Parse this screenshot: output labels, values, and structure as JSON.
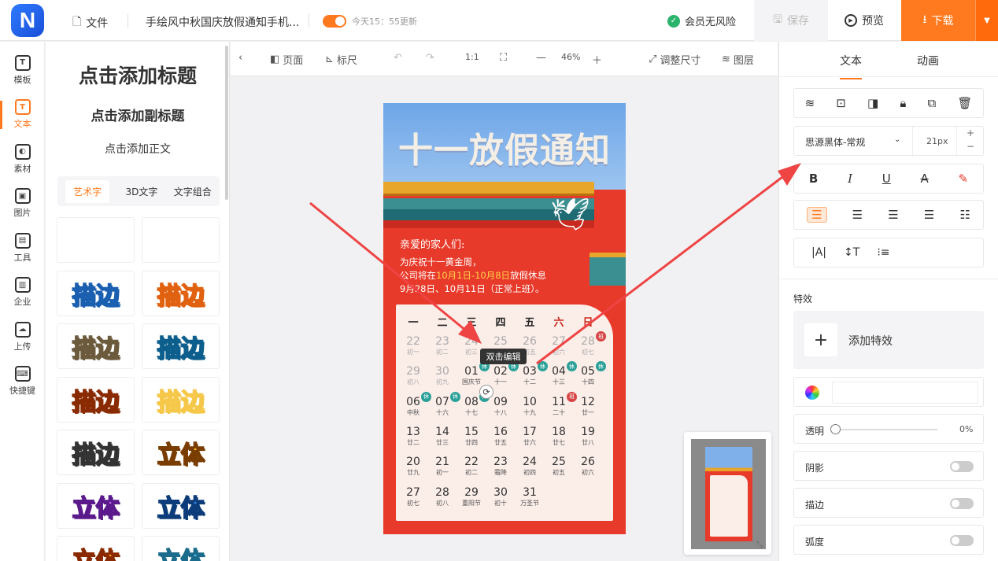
{
  "app": {
    "logo": "N"
  },
  "topbar": {
    "file_label": "文件",
    "doc_title": "手绘风中秋国庆放假通知手机...",
    "autosave_text": "今天15：55更新",
    "member_text": "会员无风险",
    "save_label": "保存",
    "preview_label": "预览",
    "download_label": "下载"
  },
  "leftnav": {
    "items": [
      {
        "label": "模板",
        "icon": "template-icon",
        "glyph": "T"
      },
      {
        "label": "文本",
        "icon": "text-icon",
        "glyph": "T",
        "active": true
      },
      {
        "label": "素材",
        "icon": "material-icon",
        "glyph": "◐"
      },
      {
        "label": "图片",
        "icon": "image-icon",
        "glyph": "▣"
      },
      {
        "label": "工具",
        "icon": "toolbox-icon",
        "glyph": "▤"
      },
      {
        "label": "企业",
        "icon": "enterprise-icon",
        "glyph": "▥"
      },
      {
        "label": "上传",
        "icon": "upload-icon",
        "glyph": "☁"
      },
      {
        "label": "快捷键",
        "icon": "keyboard-icon",
        "glyph": "⌨"
      }
    ]
  },
  "textpanel": {
    "add_title": "点击添加标题",
    "add_subtitle": "点击添加副标题",
    "add_body": "点击添加正文",
    "subtabs": [
      "艺术字",
      "3D文字",
      "文字组合"
    ],
    "tiles": [
      {
        "text": "描边",
        "color": "#222",
        "stroke": "#fff"
      },
      {
        "text": "描边",
        "color": "#ff8a1f",
        "stroke": "#fff"
      },
      {
        "text": "描边",
        "color": "#4aa6ff",
        "stroke": "#1a5fb0"
      },
      {
        "text": "描边",
        "color": "#ffb13a",
        "stroke": "#e0610f"
      },
      {
        "text": "描边",
        "color": "#fff",
        "stroke": "#6b5a3c"
      },
      {
        "text": "描边",
        "color": "#2fb2e8",
        "stroke": "#0c5e8c"
      },
      {
        "text": "描边",
        "color": "#ff9d12",
        "stroke": "#8a2a00"
      },
      {
        "text": "描边",
        "color": "#e3492c",
        "stroke": "#f6c84a"
      },
      {
        "text": "描边",
        "color": "#fff",
        "stroke": "#333"
      },
      {
        "text": "立体",
        "color": "#ffc41a",
        "stroke": "#7a3d00"
      },
      {
        "text": "立体",
        "color": "#c263f0",
        "stroke": "#5a1a8c"
      },
      {
        "text": "立体",
        "color": "#2f8ff0",
        "stroke": "#0c3d7a"
      },
      {
        "text": "立体",
        "color": "#ff9d12",
        "stroke": "#8a2a00"
      },
      {
        "text": "立体",
        "color": "#5ec8f0",
        "stroke": "#1a6b8c"
      }
    ]
  },
  "toolbar": {
    "page_label": "页面",
    "ruler_label": "标尺",
    "ratio_label": "1:1",
    "zoom": "46%",
    "resize_label": "调整尺寸",
    "layers_label": "图层"
  },
  "poster": {
    "title": "十一放假通知",
    "greeting": "亲爱的家人们:",
    "line1": "为庆祝十一黄金周，",
    "line2_pre": "公司将在",
    "line2_hl": "10月1日-10月8日",
    "line2_post": "放假休息",
    "line3": "9月28日、10月11日（正常上班）。",
    "weekdays": [
      "一",
      "二",
      "三",
      "四",
      "五",
      "六",
      "日"
    ],
    "days": [
      {
        "n": "22",
        "s": "初一",
        "dim": true
      },
      {
        "n": "23",
        "s": "初二",
        "dim": true
      },
      {
        "n": "24",
        "s": "初三",
        "dim": true
      },
      {
        "n": "25",
        "s": "初四",
        "dim": true
      },
      {
        "n": "26",
        "s": "初五",
        "dim": true
      },
      {
        "n": "27",
        "s": "初六",
        "dim": true
      },
      {
        "n": "28",
        "s": "初七",
        "dim": true,
        "badge": "班"
      },
      {
        "n": "29",
        "s": "初八",
        "dim": true
      },
      {
        "n": "30",
        "s": "初九",
        "dim": true
      },
      {
        "n": "01",
        "s": "国庆节",
        "badge": "休"
      },
      {
        "n": "02",
        "s": "十一",
        "badge": "休"
      },
      {
        "n": "03",
        "s": "十二",
        "badge": "休"
      },
      {
        "n": "04",
        "s": "十三",
        "badge": "休"
      },
      {
        "n": "05",
        "s": "十四",
        "badge": "休"
      },
      {
        "n": "06",
        "s": "中秋",
        "badge": "休"
      },
      {
        "n": "07",
        "s": "十六",
        "badge": "休"
      },
      {
        "n": "08",
        "s": "十七",
        "badge": "休"
      },
      {
        "n": "09",
        "s": "十八"
      },
      {
        "n": "10",
        "s": "十九"
      },
      {
        "n": "11",
        "s": "二十",
        "badge": "班"
      },
      {
        "n": "12",
        "s": "廿一"
      },
      {
        "n": "13",
        "s": "廿二"
      },
      {
        "n": "14",
        "s": "廿三"
      },
      {
        "n": "15",
        "s": "廿四"
      },
      {
        "n": "16",
        "s": "廿五"
      },
      {
        "n": "17",
        "s": "廿六"
      },
      {
        "n": "18",
        "s": "廿七"
      },
      {
        "n": "19",
        "s": "廿八"
      },
      {
        "n": "20",
        "s": "廿九"
      },
      {
        "n": "21",
        "s": "初一"
      },
      {
        "n": "22",
        "s": "初二"
      },
      {
        "n": "23",
        "s": "霜降"
      },
      {
        "n": "24",
        "s": "初四"
      },
      {
        "n": "25",
        "s": "初五"
      },
      {
        "n": "26",
        "s": "初六"
      },
      {
        "n": "27",
        "s": "初七"
      },
      {
        "n": "28",
        "s": "初八"
      },
      {
        "n": "29",
        "s": "重阳节"
      },
      {
        "n": "30",
        "s": "初十"
      },
      {
        "n": "31",
        "s": "万圣节"
      }
    ]
  },
  "canvas": {
    "tooltip": "双击编辑"
  },
  "rightpanel": {
    "tabs": [
      "文本",
      "动画"
    ],
    "font_family": "思源黑体-常规",
    "font_size": "21px",
    "effects_title": "特效",
    "add_effect": "添加特效",
    "opacity_label": "透明",
    "opacity_value": "0%",
    "shadow_label": "阴影",
    "stroke_label": "描边",
    "curve_label": "弧度"
  },
  "colors": {
    "accent": "#ff7a1f",
    "poster_red": "#e83a2a",
    "rest_badge": "#2aa198",
    "work_badge": "#d64545"
  }
}
